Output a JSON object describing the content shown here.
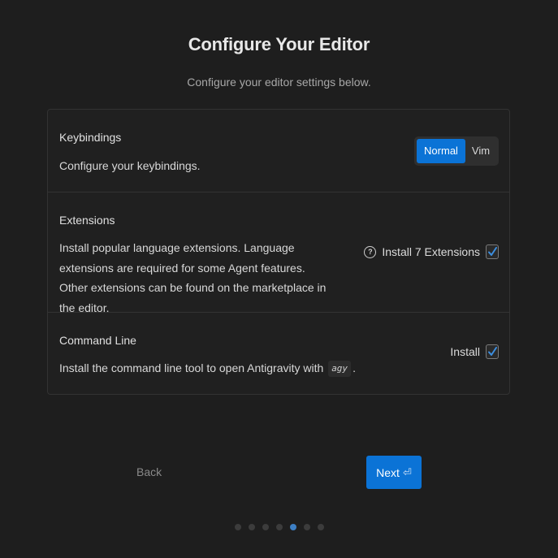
{
  "header": {
    "title": "Configure Your Editor",
    "subtitle": "Configure your editor settings below."
  },
  "keybindings": {
    "title": "Keybindings",
    "description": "Configure your keybindings.",
    "options": [
      "Normal",
      "Vim"
    ],
    "selected": "Normal"
  },
  "extensions": {
    "title": "Extensions",
    "description": "Install popular language extensions. Language extensions are required for some Agent features. Other extensions can be found on the marketplace in the editor.",
    "help_icon": "question-circle-icon",
    "install_label": "Install 7 Extensions",
    "checked": true
  },
  "command_line": {
    "title": "Command Line",
    "description_before": "Install the command line tool to open Antigravity with",
    "command": "agy",
    "description_after": ".",
    "install_label": "Install",
    "checked": true
  },
  "navigation": {
    "back_label": "Back",
    "next_label": "Next",
    "next_icon": "enter-icon"
  },
  "progress": {
    "total_steps": 7,
    "current_step": 5
  },
  "colors": {
    "accent": "#0b73d6",
    "background": "#1e1e1e"
  }
}
